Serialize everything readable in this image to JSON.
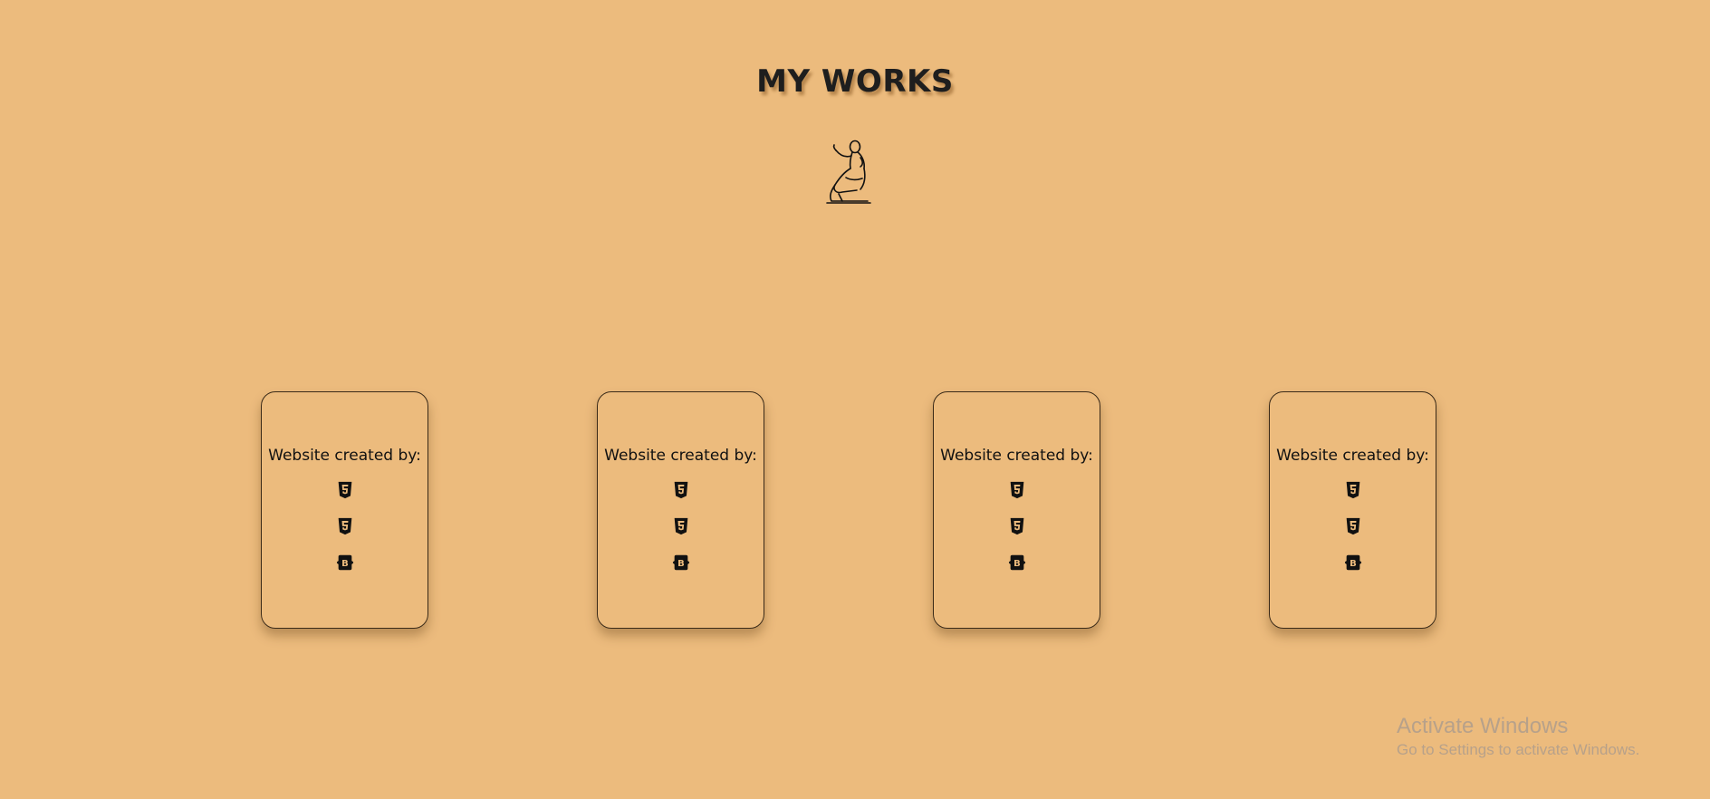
{
  "page": {
    "title": "MY WORKS",
    "background": "#ecbb7d"
  },
  "mascot": {
    "icon": "kneeling-figure-icon"
  },
  "cards": [
    {
      "label": "Website created by:",
      "tech": [
        "html5-icon",
        "css3-icon",
        "bootstrap-icon"
      ]
    },
    {
      "label": "Website created by:",
      "tech": [
        "html5-icon",
        "css3-icon",
        "bootstrap-icon"
      ]
    },
    {
      "label": "Website created by:",
      "tech": [
        "html5-icon",
        "css3-icon",
        "bootstrap-icon"
      ]
    },
    {
      "label": "Website created by:",
      "tech": [
        "html5-icon",
        "css3-icon",
        "bootstrap-icon"
      ]
    }
  ],
  "watermark": {
    "title": "Activate Windows",
    "subtitle": "Go to Settings to activate Windows."
  }
}
